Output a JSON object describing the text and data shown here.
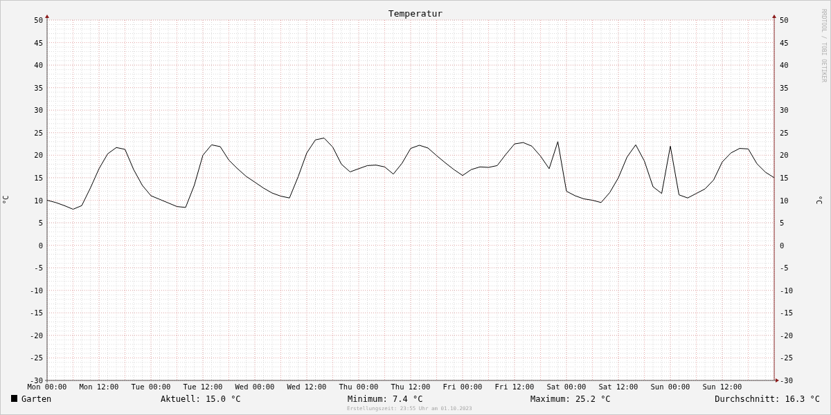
{
  "chart": {
    "title": "Temperatur",
    "chart_data": {
      "type": "line",
      "ylabel": "°C",
      "categories": [
        "Mon 00:00",
        null,
        null,
        null,
        null,
        null,
        "Mon 12:00",
        null,
        null,
        null,
        null,
        null,
        "Tue 00:00",
        null,
        null,
        null,
        null,
        null,
        "Tue 12:00",
        null,
        null,
        null,
        null,
        null,
        "Wed 00:00",
        null,
        null,
        null,
        null,
        null,
        "Wed 12:00",
        null,
        null,
        null,
        null,
        null,
        "Thu 00:00",
        null,
        null,
        null,
        null,
        null,
        "Thu 12:00",
        null,
        null,
        null,
        null,
        null,
        "Fri 00:00",
        null,
        null,
        null,
        null,
        null,
        "Fri 12:00",
        null,
        null,
        null,
        null,
        null,
        "Sat 00:00",
        null,
        null,
        null,
        null,
        null,
        "Sat 12:00",
        null,
        null,
        null,
        null,
        null,
        "Sun 00:00",
        null,
        null,
        null,
        null,
        null,
        "Sun 12:00",
        null,
        null,
        null,
        null,
        null,
        null
      ],
      "series": [
        {
          "name": "Garten",
          "color": "#000000",
          "values": [
            10,
            9.5,
            8.8,
            8,
            8.8,
            12.7,
            17,
            20.3,
            21.7,
            21.3,
            16.8,
            13.3,
            11,
            10.2,
            9.4,
            8.6,
            8.4,
            13.3,
            20,
            22.3,
            21.9,
            18.9,
            17,
            15.3,
            14,
            12.7,
            11.6,
            10.9,
            10.5,
            15.2,
            20.5,
            23.4,
            23.8,
            21.8,
            18,
            16.3,
            17,
            17.7,
            17.8,
            17.4,
            15.8,
            18.2,
            21.5,
            22.2,
            21.6,
            19.9,
            18.3,
            16.8,
            15.5,
            16.8,
            17.4,
            17.3,
            17.7,
            20.2,
            22.5,
            22.8,
            22,
            19.8,
            17,
            23,
            12,
            11,
            10.3,
            10,
            9.5,
            11.7,
            15,
            19.6,
            22.3,
            18.7,
            13,
            11.5,
            22,
            11.2,
            10.5,
            11.5,
            12.5,
            14.5,
            18.5,
            20.5,
            21.5,
            21.4,
            18.1,
            16.2,
            15
          ]
        }
      ],
      "grid": true,
      "ylim": [
        -30,
        50
      ],
      "yticks": [
        50,
        45,
        40,
        35,
        30,
        25,
        20,
        15,
        10,
        5,
        0,
        -5,
        -10,
        -15,
        -20,
        -25,
        -30
      ]
    },
    "right_axis": {
      "label": "°C",
      "ticks": [
        "50",
        "45",
        "40",
        "35",
        "30",
        "25",
        "20",
        "15",
        "10",
        "5",
        "0",
        "-5",
        "-10",
        "-15",
        "-20",
        "-25",
        "-30"
      ]
    },
    "credit": "RRDTOOL / TOBI OETIKER"
  },
  "stats": [
    "Aktuell: 15.0 °C",
    "Minimum: 7.4 °C",
    "Maximum: 25.2 °C",
    "Durchschnitt: 16.3 °C"
  ],
  "footer": "Erstellungszeit: 23:55 Uhr am 01.10.2023"
}
